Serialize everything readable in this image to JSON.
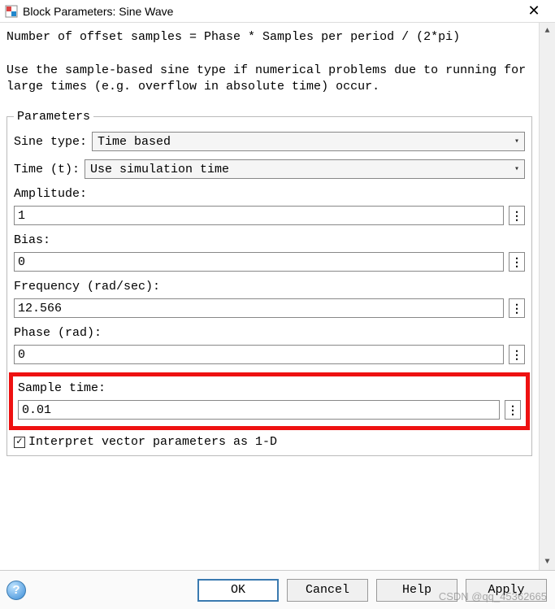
{
  "window": {
    "title": "Block Parameters: Sine Wave"
  },
  "description": {
    "line1": "Number of offset samples = Phase * Samples per period / (2*pi)",
    "line2": "Use the sample-based sine type if numerical problems due to running for large times (e.g. overflow in absolute time) occur."
  },
  "fieldset_legend": "Parameters",
  "labels": {
    "sine_type": "Sine type:",
    "time": "Time (t):",
    "amplitude": "Amplitude:",
    "bias": "Bias:",
    "frequency": "Frequency (rad/sec):",
    "phase": "Phase (rad):",
    "sample_time": "Sample time:",
    "interpret_1d": "Interpret vector parameters as 1-D"
  },
  "values": {
    "sine_type": "Time based",
    "time": "Use simulation time",
    "amplitude": "1",
    "bias": "0",
    "frequency": "12.566",
    "phase": "0",
    "sample_time": "0.01",
    "interpret_1d_checked": "✓"
  },
  "buttons": {
    "ok": "OK",
    "cancel": "Cancel",
    "help": "Help",
    "apply": "Apply"
  },
  "icons": {
    "dots": "⋮",
    "caret": "▾",
    "close": "✕",
    "help_q": "?",
    "up": "▲",
    "down": "▼"
  },
  "watermark": "CSDN @qq_45362665"
}
